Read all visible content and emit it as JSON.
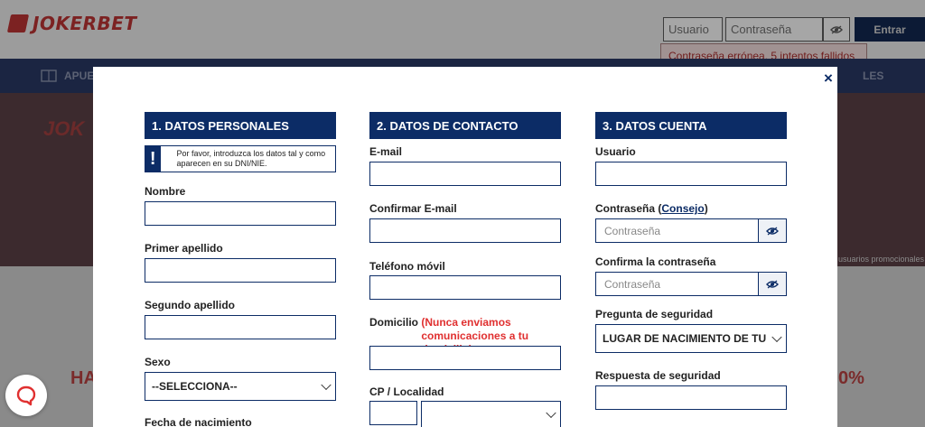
{
  "header": {
    "brand": "JOKERBET",
    "user_placeholder": "Usuario",
    "password_placeholder": "Contraseña",
    "enter_label": "Entrar",
    "error_text": "Contraseña errónea. 5 intentos fallidos"
  },
  "nav": {
    "left_label": "APUE",
    "right_label": "LES"
  },
  "background": {
    "hero_text": "JOK",
    "hero_small": "usuarios promocionales",
    "promo_left": "HA",
    "promo_right": "0%"
  },
  "modal": {
    "close_label": "×",
    "personal": {
      "title": "1. DATOS PERSONALES",
      "notice_icon": "!",
      "notice_text": "Por favor, introduzca los datos tal y como aparecen en su DNI/NIE.",
      "nombre_label": "Nombre",
      "primer_apellido_label": "Primer apellido",
      "segundo_apellido_label": "Segundo apellido",
      "sexo_label": "Sexo",
      "sexo_value": "--SELECCIONA--",
      "fecha_label": "Fecha de nacimiento"
    },
    "contact": {
      "title": "2. DATOS DE CONTACTO",
      "email_label": "E-mail",
      "confirm_email_label": "Confirmar E-mail",
      "phone_label": "Teléfono móvil",
      "domicilio_label": "Domicilio",
      "domicilio_note": "(Nunca enviamos comunicaciones a tu domicilio)",
      "cp_label": "CP / Localidad"
    },
    "account": {
      "title": "3. DATOS CUENTA",
      "usuario_label": "Usuario",
      "password_label": "Contraseña",
      "consejo_open": "(",
      "consejo_link": "Consejo",
      "consejo_close": ")",
      "password_placeholder": "Contraseña",
      "confirm_label": "Confirma la contraseña",
      "confirm_placeholder": "Contraseña",
      "question_label": "Pregunta de seguridad",
      "question_value": "LUGAR DE NACIMIENTO DE TU MADRE",
      "answer_label": "Respuesta de seguridad"
    }
  },
  "colors": {
    "navy": "#0c2c66",
    "red": "#e03030",
    "brand_red": "#d32f2f"
  }
}
